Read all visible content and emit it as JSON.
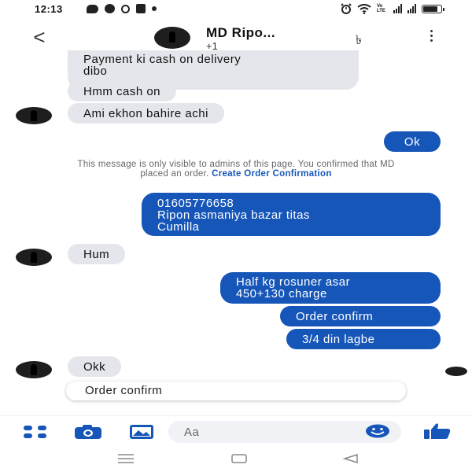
{
  "status_bar": {
    "time": "12:13",
    "volte": "Vo LTE",
    "notification_icons": [
      "message-icon",
      "messenger-icon",
      "ring-icon",
      "facebook-icon",
      "dot-icon"
    ],
    "system_icons": [
      "alarm-icon",
      "wifi-icon",
      "signal-icon",
      "battery-icon"
    ],
    "battery_level": 0.8
  },
  "header": {
    "back_icon": "back-arrow-icon",
    "name": "MD Ripo...",
    "subtitle": "+1",
    "taka_icon": "৳",
    "menu_icon": "more-vertical-icon"
  },
  "messages": [
    {
      "id": "m1",
      "direction": "in",
      "lines": [
        "Payment ki cash on delivery",
        "dibo"
      ]
    },
    {
      "id": "m2",
      "direction": "in",
      "lines": [
        "Hmm cash on"
      ]
    },
    {
      "id": "m3",
      "direction": "in",
      "lines": [
        "Ami ekhon bahire achi"
      ]
    },
    {
      "id": "m4",
      "direction": "out",
      "lines": [
        "Ok"
      ]
    },
    {
      "id": "m5",
      "direction": "out",
      "lines": [
        "01605776658",
        "Ripon asmaniya bazar titas",
        "Cumilla"
      ]
    },
    {
      "id": "m6",
      "direction": "in",
      "lines": [
        "Hum"
      ]
    },
    {
      "id": "m7",
      "direction": "out",
      "lines": [
        "Half kg rosuner asar",
        "450+130 charge"
      ]
    },
    {
      "id": "m8",
      "direction": "out",
      "lines": [
        "Order confirm"
      ]
    },
    {
      "id": "m9",
      "direction": "out",
      "lines": [
        "3/4 din lagbe"
      ]
    },
    {
      "id": "m10",
      "direction": "in",
      "lines": [
        "Okk"
      ]
    }
  ],
  "notice": {
    "text": "This message is only visible to admins of this page. You confirmed that MD placed an order.",
    "link": "Create Order Confirmation"
  },
  "suggestion": "Order confirm",
  "composer": {
    "placeholder": "Aa",
    "icons": [
      "menu-grid-icon",
      "camera-icon",
      "image-icon",
      "emoji-icon",
      "like-icon"
    ],
    "accent": "#1656b8"
  },
  "navbar": {
    "icons": [
      "recent-apps-icon",
      "home-icon",
      "back-icon"
    ]
  },
  "colors": {
    "outgoing_bubble": "#1656b8",
    "incoming_bubble": "#e4e6eb",
    "link": "#1656b8"
  }
}
